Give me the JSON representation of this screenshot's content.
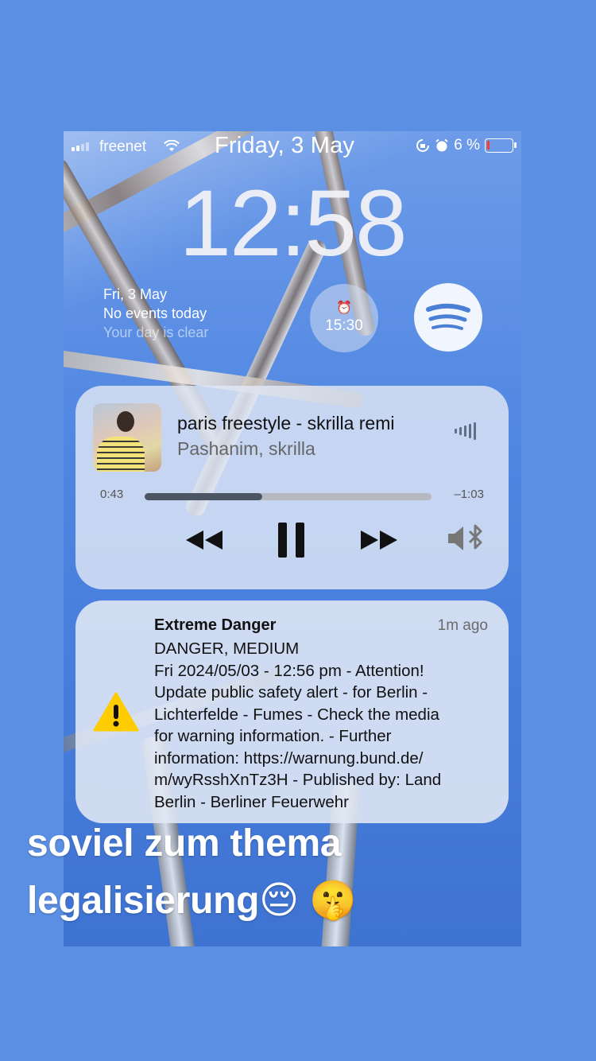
{
  "status_bar": {
    "carrier": "freenet",
    "date": "Friday, 3 May",
    "battery": "6 %",
    "battery_level": 0.06
  },
  "lock_screen": {
    "time": "12:58"
  },
  "calendar_widget": {
    "date": "Fri, 3 May",
    "line1": "No events today",
    "line2": "Your day is clear"
  },
  "alarm_widget": {
    "time": "15:30"
  },
  "now_playing": {
    "title": "paris freestyle - skrilla remi",
    "artist": "Pashanim, skrilla",
    "elapsed": "0:43",
    "remaining": "–1:03",
    "progress": 0.41
  },
  "notification": {
    "title": "Extreme Danger",
    "time": "1m ago",
    "body": "DANGER, MEDIUM\nFri 2024/05/03 - 12:56 pm - Attention!\nUpdate public safety alert - for Berlin -\nLichterfelde - Fumes - Check the media\nfor warning information. - Further\ninformation: https://warnung.bund.de/\nm/wyRsshXnTz3H - Published by: Land\nBerlin - Berliner Feuerwehr"
  },
  "caption": {
    "line1": "soviel zum thema",
    "line2": "legalisierung😔 🤫"
  },
  "colors": {
    "background": "#5b8fe3",
    "battery_low": "#ff3b30",
    "warning": "#ffcc00"
  }
}
